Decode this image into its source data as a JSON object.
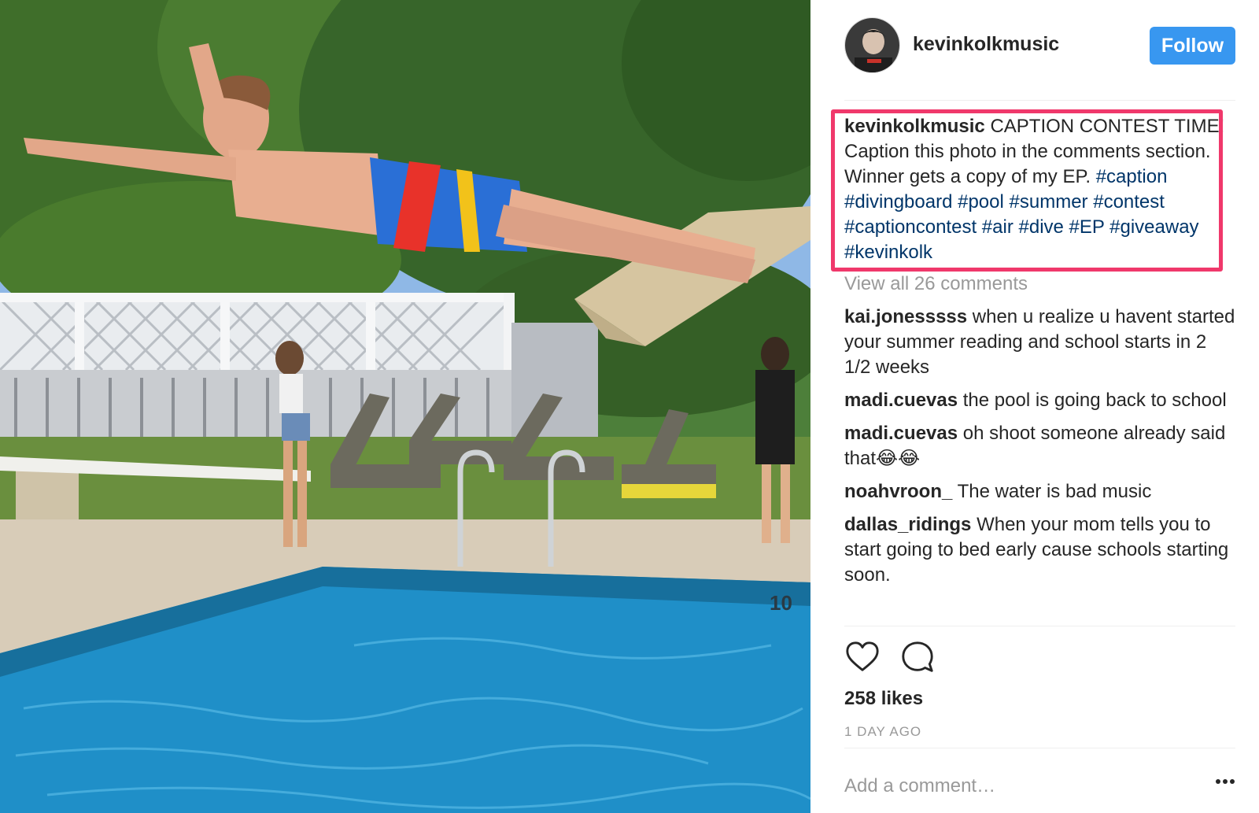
{
  "post": {
    "author": "kevinkolkmusic",
    "follow_label": "Follow",
    "caption": {
      "username": "kevinkolkmusic",
      "text": "CAPTION CONTEST TIME! Caption this photo in the comments section. Winner gets a copy of my EP.",
      "hashtags": [
        "#caption",
        "#divingboard",
        "#pool",
        "#summer",
        "#contest",
        "#captioncontest",
        "#air",
        "#dive",
        "#EP",
        "#giveaway",
        "#kevinkolk"
      ]
    },
    "view_all_comments": "View all 26 comments",
    "comments": [
      {
        "username": "kai.jonesssss",
        "text": "when u realize u havent started your summer reading and school starts in 2 1/2 weeks"
      },
      {
        "username": "madi.cuevas",
        "text": "the pool is going back to school"
      },
      {
        "username": "madi.cuevas",
        "text": "oh shoot someone already said that😂😂"
      },
      {
        "username": "noahvroon_",
        "text": "The water is bad music"
      },
      {
        "username": "dallas_ridings",
        "text": "When your mom tells you to start going to bed early cause schools starting soon."
      }
    ],
    "likes": "258 likes",
    "time_ago": "1 DAY AGO",
    "add_comment_placeholder": "Add a comment…",
    "pool_depth_marker": "10"
  },
  "icons": {
    "like": "heart-icon",
    "comment": "speech-bubble-icon",
    "more": "more-options-icon"
  },
  "colors": {
    "follow_button": "#3897f0",
    "hashtag": "#003569",
    "highlight_box": "#f0386b",
    "muted_text": "#999999"
  }
}
